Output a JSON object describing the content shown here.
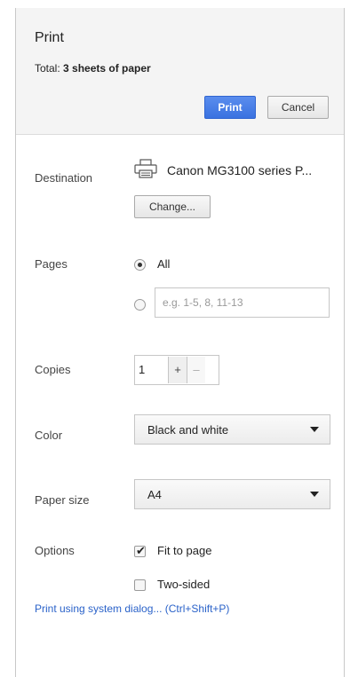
{
  "header": {
    "title": "Print",
    "total_prefix": "Total: ",
    "total_value": "3 sheets of paper",
    "print_label": "Print",
    "cancel_label": "Cancel"
  },
  "destination": {
    "label": "Destination",
    "printer_icon": "printer-icon",
    "printer_name": "Canon MG3100 series P...",
    "change_label": "Change..."
  },
  "pages": {
    "label": "Pages",
    "all_label": "All",
    "all_selected": true,
    "custom_placeholder": "e.g. 1-5, 8, 11-13"
  },
  "copies": {
    "label": "Copies",
    "value": "1",
    "plus": "+",
    "minus": "–"
  },
  "color": {
    "label": "Color",
    "selected": "Black and white"
  },
  "paper_size": {
    "label": "Paper size",
    "selected": "A4"
  },
  "options": {
    "label": "Options",
    "fit_to_page": {
      "label": "Fit to page",
      "checked": true
    },
    "two_sided": {
      "label": "Two-sided",
      "checked": false
    }
  },
  "system_dialog_link": "Print using system dialog... (Ctrl+Shift+P)",
  "colors": {
    "accent": "#3a72e0",
    "link": "#2a62c9"
  }
}
